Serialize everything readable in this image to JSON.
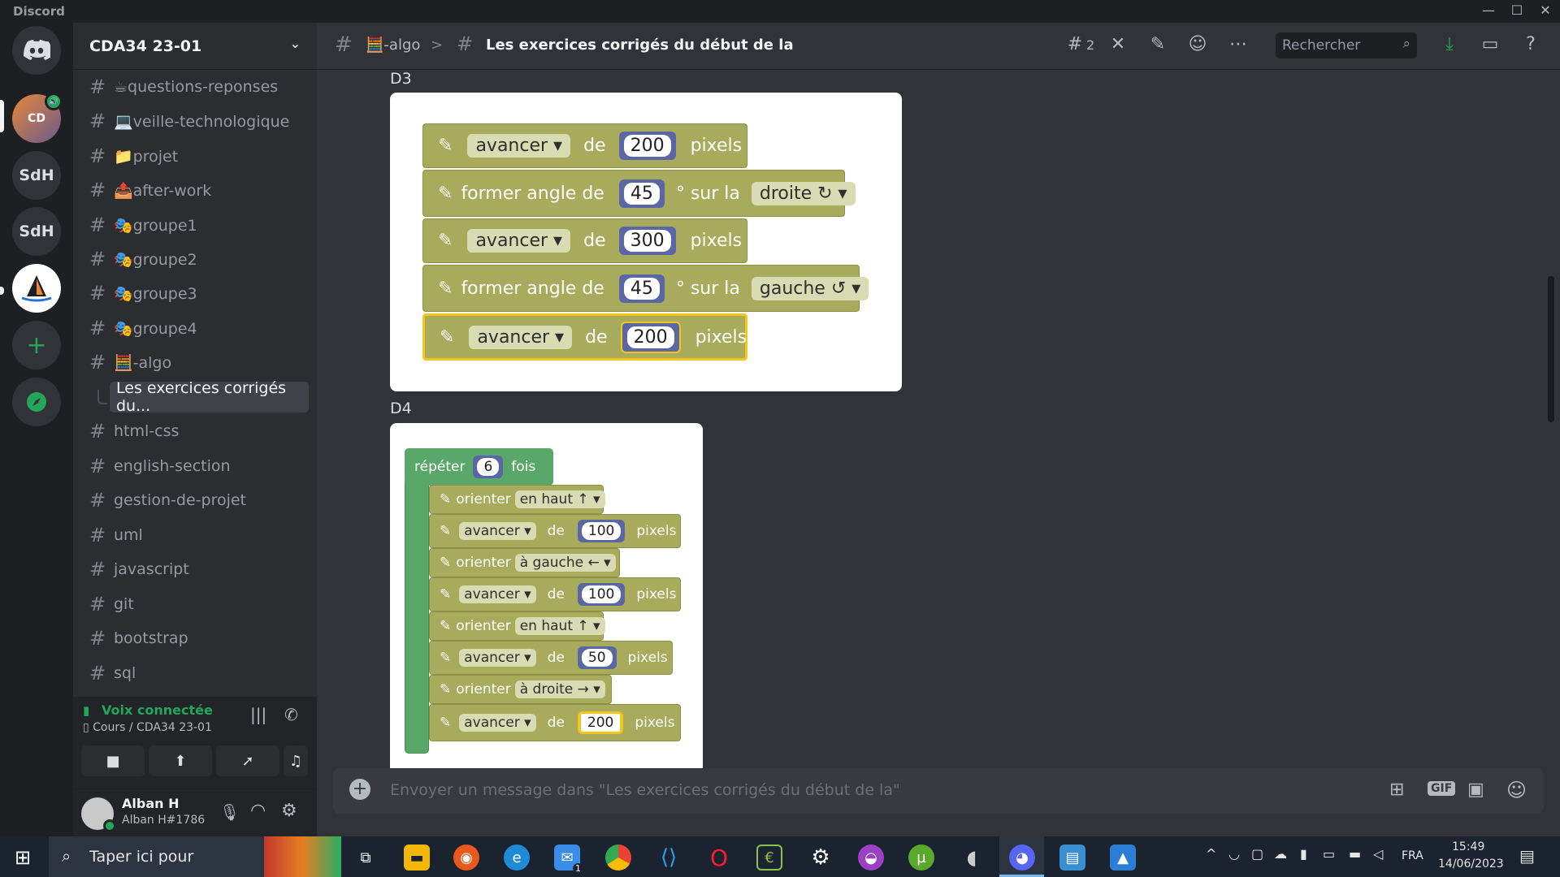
{
  "window": {
    "title": "Discord"
  },
  "server_rail": {
    "items": [
      {
        "label": "",
        "icon": "discord-logo-icon"
      },
      {
        "label": "",
        "icon": "server-cda34-avatar"
      },
      {
        "label": "SdH"
      },
      {
        "label": "SdH"
      },
      {
        "label": "",
        "icon": "sailboat-server-icon"
      },
      {
        "label": "+",
        "icon": "add-server-icon"
      },
      {
        "label": "",
        "icon": "explore-compass-icon"
      }
    ]
  },
  "guild": {
    "name": "CDA34 23-01"
  },
  "channels": [
    {
      "name": "☕questions-reponses"
    },
    {
      "name": "💻veille-technologique"
    },
    {
      "name": "📁projet"
    },
    {
      "name": "📤after-work"
    },
    {
      "name": "🎭groupe1"
    },
    {
      "name": "🎭groupe2"
    },
    {
      "name": "🎭groupe3"
    },
    {
      "name": "🎭groupe4"
    },
    {
      "name": "🧮-algo"
    },
    {
      "name": "html-css"
    },
    {
      "name": "english-section"
    },
    {
      "name": "gestion-de-projet"
    },
    {
      "name": "uml"
    },
    {
      "name": "javascript"
    },
    {
      "name": "git"
    },
    {
      "name": "bootstrap"
    },
    {
      "name": "sql"
    }
  ],
  "active_thread": {
    "name": "Les exercices corrigés du..."
  },
  "voice": {
    "status": "Voix connectée",
    "location": "Cours / CDA34 23-01"
  },
  "user": {
    "name": "Alban H",
    "tag": "Alban H#1786"
  },
  "header": {
    "parent_channel": "🧮-algo",
    "separator": ">",
    "thread_title": "Les exercices corrigés du début de la",
    "threads_count": "2",
    "search_placeholder": "Rechercher"
  },
  "messages": {
    "d3": {
      "label": "D3",
      "blocks": [
        {
          "kind": "avancer",
          "text1": "avancer",
          "text2": "de",
          "value": "200",
          "text3": "pixels"
        },
        {
          "kind": "angle",
          "text1": "former angle de",
          "value": "45",
          "text2": "° sur la",
          "dir": "droite ↻"
        },
        {
          "kind": "avancer",
          "text1": "avancer",
          "text2": "de",
          "value": "300",
          "text3": "pixels"
        },
        {
          "kind": "angle",
          "text1": "former angle de",
          "value": "45",
          "text2": "° sur la",
          "dir": "gauche ↺"
        },
        {
          "kind": "avancer",
          "text1": "avancer",
          "text2": "de",
          "value": "200",
          "text3": "pixels",
          "selected": true
        }
      ]
    },
    "d4": {
      "label": "D4",
      "repeat": {
        "text1": "répéter",
        "value": "6",
        "text2": "fois"
      },
      "blocks": [
        {
          "kind": "orienter",
          "text1": "orienter",
          "dir": "en haut ↑"
        },
        {
          "kind": "avancer",
          "text1": "avancer",
          "text2": "de",
          "value": "100",
          "text3": "pixels"
        },
        {
          "kind": "orienter",
          "text1": "orienter",
          "dir": "à gauche ←"
        },
        {
          "kind": "avancer",
          "text1": "avancer",
          "text2": "de",
          "value": "100",
          "text3": "pixels"
        },
        {
          "kind": "orienter",
          "text1": "orienter",
          "dir": "en haut ↑"
        },
        {
          "kind": "avancer",
          "text1": "avancer",
          "text2": "de",
          "value": "50",
          "text3": "pixels"
        },
        {
          "kind": "orienter",
          "text1": "orienter",
          "dir": "à droite →"
        },
        {
          "kind": "avancer",
          "text1": "avancer",
          "text2": "de",
          "value": "200",
          "text3": "pixels",
          "editing": true
        }
      ]
    }
  },
  "composer": {
    "placeholder": "Envoyer un message dans \"Les exercices corrigés du début de la\"",
    "gif_label": "GIF"
  },
  "taskbar": {
    "search_placeholder": "Taper ici pour",
    "language": "FRA",
    "time": "15:49",
    "date": "14/06/2023",
    "mail_badge": "1"
  },
  "colors": {
    "accent": "#23a55a",
    "block_olive": "#a8ab5b",
    "block_green": "#59a869",
    "block_value": "#5b67a5",
    "selection": "#f5c518"
  }
}
